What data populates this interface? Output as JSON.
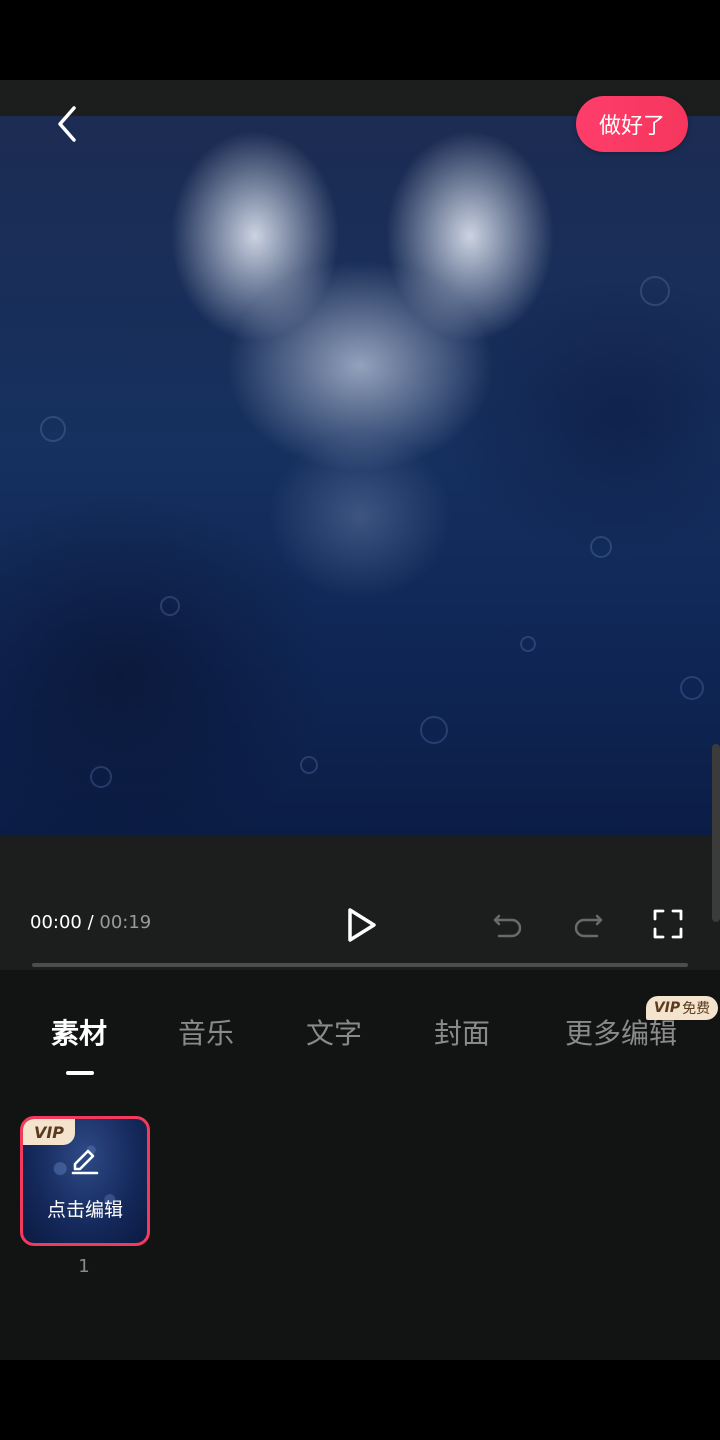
{
  "header": {
    "back_icon": "chevron-left-icon",
    "done_label": "做好了"
  },
  "player": {
    "current_time": "00:00",
    "separator": " / ",
    "total_time": "00:19",
    "play_icon": "play-icon",
    "undo_icon": "undo-icon",
    "redo_icon": "redo-icon",
    "fullscreen_icon": "fullscreen-icon",
    "progress": 0
  },
  "tabs": [
    {
      "label": "素材",
      "active": true
    },
    {
      "label": "音乐",
      "active": false
    },
    {
      "label": "文字",
      "active": false
    },
    {
      "label": "封面",
      "active": false
    },
    {
      "label": "更多编辑",
      "active": false
    }
  ],
  "vip_free_badge": {
    "vip": "VIP",
    "text": "免费"
  },
  "clips": [
    {
      "vip_badge": "VIP",
      "label": "点击编辑",
      "index": "1",
      "icon": "edit-pencil-icon"
    }
  ],
  "colors": {
    "accent": "#f5365c",
    "vip_badge_bg": "#f4e3cd",
    "panel_bg": "#121313",
    "controls_bg": "#1c1d1d"
  }
}
